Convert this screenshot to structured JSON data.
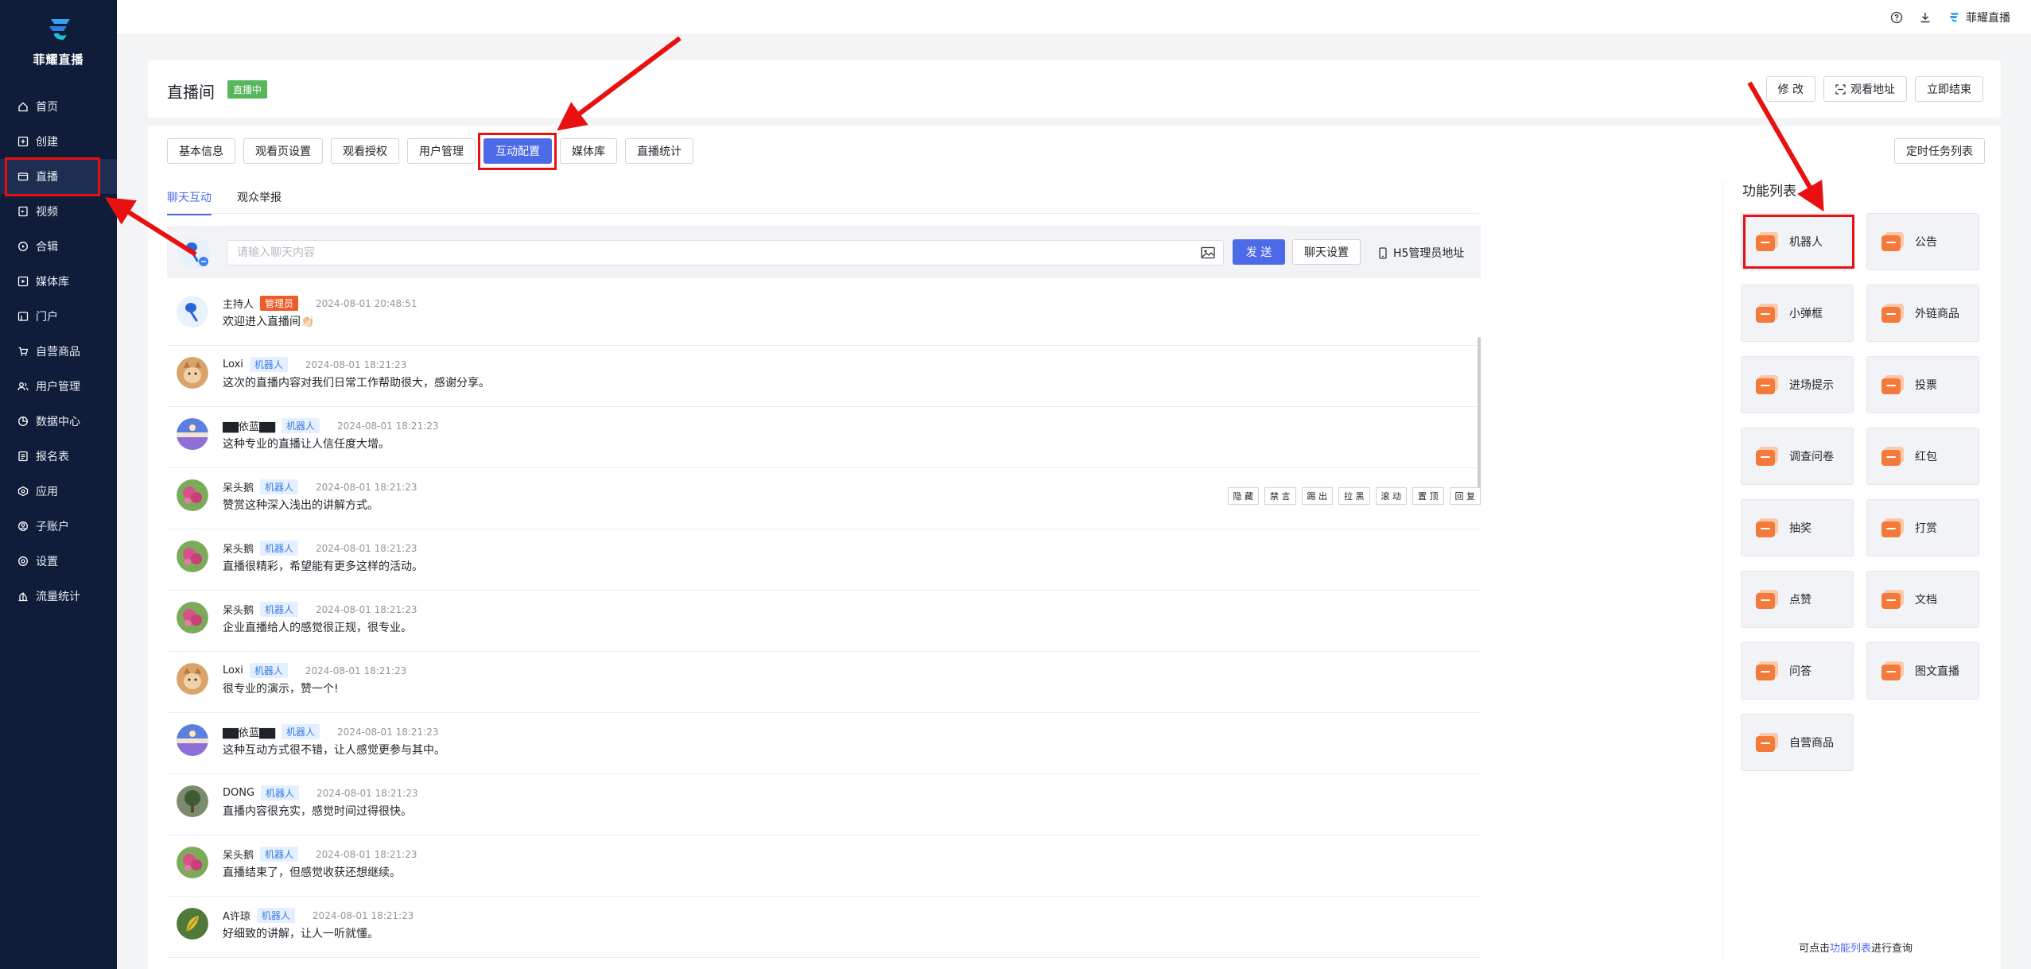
{
  "brand": {
    "name": "菲耀直播"
  },
  "sidebar": {
    "items": [
      {
        "label": "首页",
        "icon": "home-icon"
      },
      {
        "label": "创建",
        "icon": "plus-square-icon"
      },
      {
        "label": "直播",
        "icon": "video-icon",
        "active": true
      },
      {
        "label": "视频",
        "icon": "film-icon"
      },
      {
        "label": "合辑",
        "icon": "collection-icon"
      },
      {
        "label": "媒体库",
        "icon": "media-icon"
      },
      {
        "label": "门户",
        "icon": "portal-icon"
      },
      {
        "label": "自营商品",
        "icon": "cart-icon"
      },
      {
        "label": "用户管理",
        "icon": "users-icon"
      },
      {
        "label": "数据中心",
        "icon": "chart-pie-icon"
      },
      {
        "label": "报名表",
        "icon": "form-icon"
      },
      {
        "label": "应用",
        "icon": "apps-icon"
      },
      {
        "label": "子账户",
        "icon": "user-icon"
      },
      {
        "label": "设置",
        "icon": "gear-icon"
      },
      {
        "label": "流量统计",
        "icon": "traffic-icon"
      }
    ]
  },
  "topbar": {
    "account": "菲耀直播"
  },
  "header": {
    "title": "直播间",
    "status": "直播中",
    "buttons": {
      "edit": "修 改",
      "watch_url": "观看地址",
      "end": "立即结束"
    }
  },
  "tabs": [
    "基本信息",
    "观看页设置",
    "观看授权",
    "用户管理",
    "互动配置",
    "媒体库",
    "直播统计"
  ],
  "schedule_button": "定时任务列表",
  "subtabs": [
    "聊天互动",
    "观众举报"
  ],
  "chat": {
    "placeholder": "请输入聊天内容",
    "send": "发 送",
    "settings": "聊天设置",
    "h5": "H5管理员地址",
    "actions": [
      "隐 藏",
      "禁 言",
      "踢 出",
      "拉 黑",
      "滚 动",
      "置 顶",
      "回 复"
    ],
    "messages": [
      {
        "name": "主持人",
        "badge": "管理员",
        "badge_type": "admin",
        "time": "2024-08-01 20:48:51",
        "text": "欢迎进入直播间👏🏻",
        "avatar": "host"
      },
      {
        "name": "Loxi",
        "badge": "机器人",
        "badge_type": "robot",
        "time": "2024-08-01 18:21:23",
        "text": "这次的直播内容对我们日常工作帮助很大，感谢分享。",
        "avatar": "cat"
      },
      {
        "name": "▇▇依蓝▇▇",
        "badge": "机器人",
        "badge_type": "robot",
        "time": "2024-08-01 18:21:23",
        "text": "这种专业的直播让人信任度大增。",
        "avatar": "sky"
      },
      {
        "name": "呆头鹅",
        "badge": "机器人",
        "badge_type": "robot",
        "time": "2024-08-01 18:21:23",
        "text": "赞赏这种深入浅出的讲解方式。",
        "avatar": "flower"
      },
      {
        "name": "呆头鹅",
        "badge": "机器人",
        "badge_type": "robot",
        "time": "2024-08-01 18:21:23",
        "text": "直播很精彩，希望能有更多这样的活动。",
        "avatar": "flower"
      },
      {
        "name": "呆头鹅",
        "badge": "机器人",
        "badge_type": "robot",
        "time": "2024-08-01 18:21:23",
        "text": "企业直播给人的感觉很正规，很专业。",
        "avatar": "flower"
      },
      {
        "name": "Loxi",
        "badge": "机器人",
        "badge_type": "robot",
        "time": "2024-08-01 18:21:23",
        "text": "很专业的演示，赞一个!",
        "avatar": "cat"
      },
      {
        "name": "▇▇依蓝▇▇",
        "badge": "机器人",
        "badge_type": "robot",
        "time": "2024-08-01 18:21:23",
        "text": "这种互动方式很不错，让人感觉更参与其中。",
        "avatar": "sky"
      },
      {
        "name": "DONG",
        "badge": "机器人",
        "badge_type": "robot",
        "time": "2024-08-01 18:21:23",
        "text": "直播内容很充实，感觉时间过得很快。",
        "avatar": "tree"
      },
      {
        "name": "呆头鹅",
        "badge": "机器人",
        "badge_type": "robot",
        "time": "2024-08-01 18:21:23",
        "text": "直播结束了，但感觉收获还想继续。",
        "avatar": "flower"
      },
      {
        "name": "A许琼",
        "badge": "机器人",
        "badge_type": "robot",
        "time": "2024-08-01 18:21:23",
        "text": "好细致的讲解，让人一听就懂。",
        "avatar": "leaf"
      }
    ]
  },
  "function_panel": {
    "title": "功能列表",
    "items": [
      {
        "label": "机器人",
        "icon": "robot-icon"
      },
      {
        "label": "公告",
        "icon": "announcement-icon"
      },
      {
        "label": "小弹框",
        "icon": "popup-icon"
      },
      {
        "label": "外链商品",
        "icon": "external-product-icon"
      },
      {
        "label": "进场提示",
        "icon": "entry-tip-icon"
      },
      {
        "label": "投票",
        "icon": "vote-icon"
      },
      {
        "label": "调查问卷",
        "icon": "survey-icon"
      },
      {
        "label": "红包",
        "icon": "red-packet-icon"
      },
      {
        "label": "抽奖",
        "icon": "lottery-icon"
      },
      {
        "label": "打赏",
        "icon": "reward-icon"
      },
      {
        "label": "点赞",
        "icon": "like-icon"
      },
      {
        "label": "文档",
        "icon": "document-icon"
      },
      {
        "label": "问答",
        "icon": "qa-icon"
      },
      {
        "label": "图文直播",
        "icon": "image-text-icon"
      },
      {
        "label": "自营商品",
        "icon": "own-product-icon"
      }
    ],
    "hint_before": "可点击",
    "hint_link": "功能列表",
    "hint_after": "进行查询"
  },
  "colors": {
    "sidebar_bg": "#0f1d3a",
    "accent": "#4d6ae8",
    "live_green": "#58b65c",
    "admin_orange": "#ec5d2a",
    "tile_orange": "#f47a3b",
    "annotation_red": "#e81010"
  }
}
